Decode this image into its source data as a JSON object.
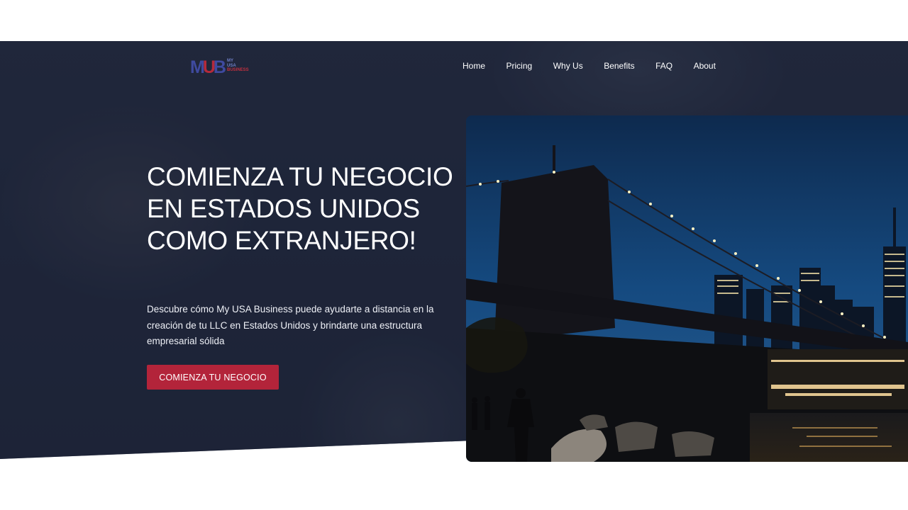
{
  "brand": {
    "mark_left": "M",
    "mark_mid": "U",
    "mark_right": "B",
    "line1": "MY",
    "line2": "USA",
    "line3": "BUSINESS"
  },
  "nav": {
    "items": [
      {
        "label": "Home"
      },
      {
        "label": "Pricing"
      },
      {
        "label": "Why Us"
      },
      {
        "label": "Benefits"
      },
      {
        "label": "FAQ"
      },
      {
        "label": "About"
      }
    ]
  },
  "hero": {
    "headline": "COMIENZA TU NEGOCIO EN ESTADOS UNIDOS COMO EXTRANJERO!",
    "description": "Descubre cómo My USA Business puede ayudarte a distancia en la creación de tu LLC en Estados Unidos y brindarte una estructura empresarial sólida",
    "cta_label": "COMIENZA TU NEGOCIO"
  },
  "colors": {
    "hero_bg": "#242a3e",
    "accent": "#b3243a",
    "brand_blue": "#3f4aa0"
  },
  "images": {
    "hero_photo": "night-city-bridge-photo"
  }
}
